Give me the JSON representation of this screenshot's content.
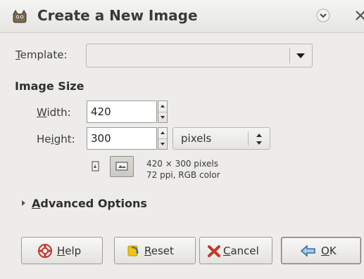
{
  "window": {
    "title": "Create a New Image"
  },
  "template": {
    "label": "Template:",
    "label_underline": "T",
    "label_rest": "emplate:",
    "value": ""
  },
  "image_size": {
    "section_title": "Image Size",
    "width_label_underline": "W",
    "width_label_rest": "idth:",
    "width_value": "420",
    "height_label_pre": "He",
    "height_label_underline": "i",
    "height_label_rest": "ght:",
    "height_value": "300",
    "unit": "pixels",
    "info_line1": "420 × 300 pixels",
    "info_line2": "72 ppi, RGB color"
  },
  "advanced": {
    "label_underline": "A",
    "label_rest": "dvanced Options"
  },
  "buttons": {
    "help_underline": "H",
    "help_rest": "elp",
    "reset_underline": "R",
    "reset_rest": "eset",
    "cancel_underline": "C",
    "cancel_rest": "ancel",
    "ok_underline": "O",
    "ok_rest": "K"
  },
  "icons": {
    "title": "gimp-wilber-icon",
    "minimize": "minimize-icon",
    "close": "close-icon",
    "portrait": "portrait-orientation-icon",
    "landscape": "landscape-orientation-icon",
    "help": "help-icon",
    "reset": "reset-icon",
    "cancel": "cancel-icon",
    "ok": "ok-icon"
  },
  "colors": {
    "background": "#edeceb",
    "field_background": "#ffffff",
    "text": "#2e3436"
  }
}
